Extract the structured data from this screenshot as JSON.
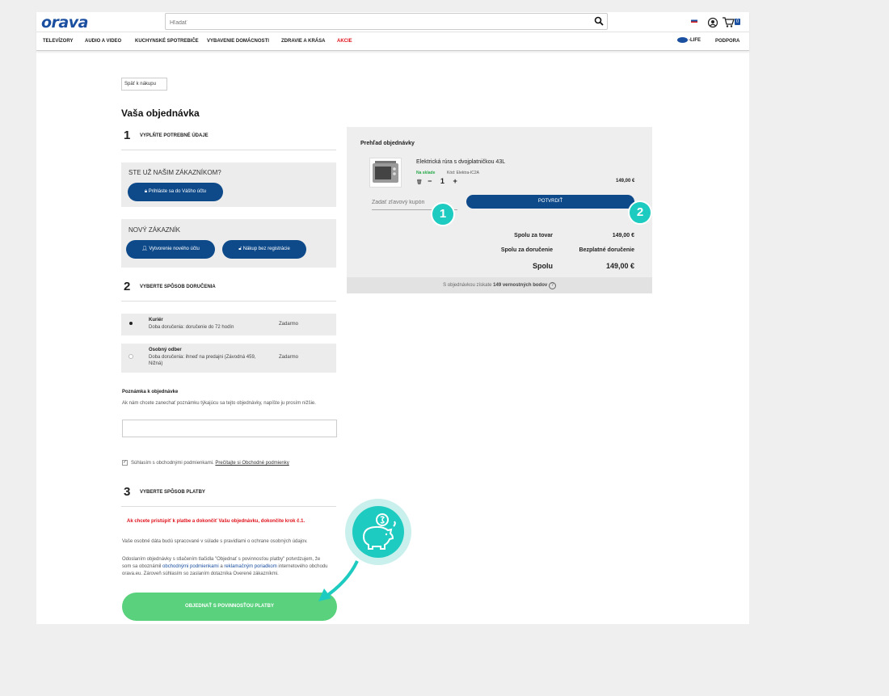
{
  "header": {
    "logo": "orava",
    "search_placeholder": "Hľadať",
    "cart_count": "0",
    "nav": [
      "TELEVÍZORY",
      "AUDIO A VIDEO",
      "KUCHYNSKÉ SPOTREBIČE",
      "VYBAVENIE DOMÁCNOSTI",
      "ZDRAVIE A KRÁSA",
      "AKCIE"
    ],
    "life_label": "-LIFE",
    "support_label": "PODPORA"
  },
  "back_label": "Späť k nákupu",
  "order_title": "Vaša objednávka",
  "steps": [
    {
      "num": "1",
      "label": "VYPLŇTE POTREBNÉ ÚDAJE"
    },
    {
      "num": "2",
      "label": "VYBERTE SPÔSOB DORUČENIA"
    },
    {
      "num": "3",
      "label": "VYBERTE SPÔSOB PLATBY"
    }
  ],
  "existing_customer": {
    "title": "STE UŽ NAŠIM ZÁKAZNÍKOM?",
    "login_button": "Prihláste sa do Vášho účtu"
  },
  "new_customer": {
    "title": "NOVÝ ZÁKAZNÍK",
    "create_button": "Vytvorenie nového účtu",
    "guest_button": "Nákup bez registrácie"
  },
  "shipping": [
    {
      "name": "Kuriér",
      "desc": "Doba doručenia: doručenie do 72 hodín",
      "price": "Zadarmo",
      "selected": true
    },
    {
      "name": "Osobný odber",
      "desc": "Doba doručenia: ihneď na predajni (Závodná 459, Nižná)",
      "price": "Zadarmo",
      "selected": false
    }
  ],
  "note": {
    "title": "Poznámka k objednávke",
    "desc": "Ak nám chcete zanechať poznámku týkajúcu sa tejto objednávky, napíšte ju prosím nižšie.",
    "value": ""
  },
  "terms": {
    "text": "Súhlasím s obchodnými podmienkami.",
    "link": "Prečítajte si Obchodné podmienky",
    "checked": true
  },
  "payment_warning": "Ak chcete pristúpiť k platbe a dokončiť Vašu objednávku, dokončite krok č.1.",
  "privacy_text": "Vaše osobné dáta budú spracované v súlade s pravidlami o ochrane osobných údajov.",
  "consent": {
    "part1": "Odoslaním objednávky s stlačením tlačidla \"Objednať s povinnosťou platby\" potvrdzujem, že som sa oboznámil ",
    "link1": "obchodnými podmienkami",
    "part2": " a ",
    "link2": "reklamačným poriadkom",
    "part3": " internetového obchodu orava.eu. Zároveň súhlasím so zaslaním dotazníka Overené zákazníkmi."
  },
  "order_button": "OBJEDNAŤ S POVINNOSŤOU PLATBY",
  "summary": {
    "title": "Prehľad objednávky",
    "product_name": "Elektrická rúra s dvojplatničkou 43L",
    "stock": "Na sklade",
    "code": "Kód: Elektra-IC2A",
    "qty_minus": "−",
    "qty": "1",
    "qty_plus": "+",
    "product_price": "149,00 €",
    "coupon_placeholder": "Zadať zľavový kupón",
    "confirm_button": "POTVRDIŤ",
    "goods_label": "Spolu za tovar",
    "goods_value": "149,00 €",
    "delivery_label": "Spolu za doručenie",
    "delivery_value": "Bezplatné doručenie",
    "total_label": "Spolu",
    "total_value": "149,00 €",
    "loyalty_pre": "S objednávkou získate ",
    "loyalty_bold": "149 vernostných bodov",
    "help": "?"
  },
  "badges": [
    "1",
    "2"
  ],
  "colors": {
    "brand": "#0e4a8a",
    "accent": "#1ecbc0",
    "cta": "#5ad17d",
    "warning": "#e0111b"
  }
}
